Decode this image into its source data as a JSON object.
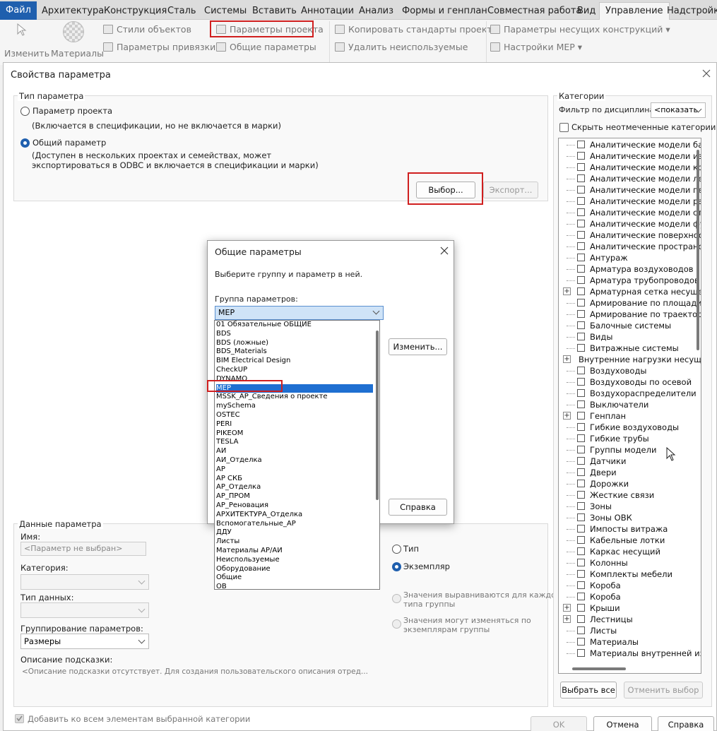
{
  "ribbon_tabs": [
    "Файл",
    "Архитектура",
    "Конструкция",
    "Сталь",
    "Системы",
    "Вставить",
    "Аннотации",
    "Анализ",
    "Формы и генплан",
    "Совместная работа",
    "Вид",
    "Управление",
    "Надстройки"
  ],
  "ribbon": {
    "modify": "Изменить",
    "materials": "Материалы",
    "object_styles": "Стили объектов",
    "snap_settings": "Параметры привязки",
    "project_parameters": "Параметры проекта",
    "shared_parameters": "Общие параметры",
    "transfer_standards": "Копировать стандарты проекта",
    "purge_unused": "Удалить неиспользуемые",
    "structural_settings": "Параметры несущих конструкций ▾",
    "mep_settings": "Настройки MEP ▾"
  },
  "dialog": {
    "title": "Свойства параметра",
    "param_type_group": "Тип параметра",
    "project_param": "Параметр проекта",
    "project_param_desc": "(Включается в спецификации, но не включается в марки)",
    "shared_param": "Общий параметр",
    "shared_param_desc1": "(Доступен в нескольких проектах и семействах, может",
    "shared_param_desc2": "экспортироваться в ODBC и включается в спецификации и марки)",
    "select_btn": "Выбор...",
    "export_btn": "Экспорт...",
    "param_data_group": "Данные параметра",
    "name_label": "Имя:",
    "name_placeholder": "<Параметр не выбран>",
    "category_label": "Категория:",
    "datatype_label": "Тип данных:",
    "grouping_label": "Группирование параметров:",
    "grouping_value": "Размеры",
    "tooltip_label": "Описание подсказки:",
    "tooltip_value": "<Описание подсказки отсутствует. Для создания пользовательского описания отред...",
    "type_radio": "Тип",
    "instance_radio": "Экземпляр",
    "align_values": "Значения выравниваются для каждого",
    "align_values2": "типа группы",
    "vary_values": "Значения могут изменяться по",
    "vary_values2": "экземплярам группы",
    "add_to_all": "Добавить ко всем элементам выбранной категории",
    "ok": "OK",
    "cancel": "Отмена",
    "help": "Справка"
  },
  "categories": {
    "title": "Категории",
    "filter_label": "Фильтр по дисциплинам:",
    "filter_value": "<показать",
    "hide_unchecked": "Скрыть неотмеченные категории",
    "select_all": "Выбрать все",
    "deselect": "Отменить выбор",
    "items": [
      {
        "label": "Аналитические модели бал",
        "expand": false
      },
      {
        "label": "Аналитические модели изо",
        "expand": false
      },
      {
        "label": "Аналитические модели кол",
        "expand": false
      },
      {
        "label": "Аналитические модели лен",
        "expand": false
      },
      {
        "label": "Аналитические модели пер",
        "expand": false
      },
      {
        "label": "Аналитические модели рас",
        "expand": false
      },
      {
        "label": "Аналитические модели ст...",
        "expand": false
      },
      {
        "label": "Аналитические модели фун",
        "expand": false
      },
      {
        "label": "Аналитические поверхнос...",
        "expand": false
      },
      {
        "label": "Аналитические пространст",
        "expand": false
      },
      {
        "label": "Антураж",
        "expand": false
      },
      {
        "label": "Арматура воздуховодов",
        "expand": false
      },
      {
        "label": "Арматура трубопроводов",
        "expand": false
      },
      {
        "label": "Арматурная сетка несущей",
        "expand": true
      },
      {
        "label": "Армирование по площади н",
        "expand": false
      },
      {
        "label": "Армирование по траектори",
        "expand": false
      },
      {
        "label": "Балочные системы",
        "expand": false
      },
      {
        "label": "Виды",
        "expand": false
      },
      {
        "label": "Витражные системы",
        "expand": false
      },
      {
        "label": "Внутренние нагрузки несущих",
        "expand": true,
        "nocheck": true
      },
      {
        "label": "Воздуховоды",
        "expand": false
      },
      {
        "label": "Воздуховоды по осевой",
        "expand": false
      },
      {
        "label": "Воздухораспределители",
        "expand": false
      },
      {
        "label": "Выключатели",
        "expand": false
      },
      {
        "label": "Генплан",
        "expand": true
      },
      {
        "label": "Гибкие воздуховоды",
        "expand": false
      },
      {
        "label": "Гибкие трубы",
        "expand": false
      },
      {
        "label": "Группы модели",
        "expand": false
      },
      {
        "label": "Датчики",
        "expand": false
      },
      {
        "label": "Двери",
        "expand": false
      },
      {
        "label": "Дорожки",
        "expand": false
      },
      {
        "label": "Жесткие связи",
        "expand": false
      },
      {
        "label": "Зоны",
        "expand": false
      },
      {
        "label": "Зоны ОВК",
        "expand": false
      },
      {
        "label": "Импосты витража",
        "expand": false
      },
      {
        "label": "Кабельные лотки",
        "expand": false
      },
      {
        "label": "Каркас несущий",
        "expand": false
      },
      {
        "label": "Колонны",
        "expand": false
      },
      {
        "label": "Комплекты мебели",
        "expand": false
      },
      {
        "label": "Короба",
        "expand": false
      },
      {
        "label": "Короба",
        "expand": false
      },
      {
        "label": "Крыши",
        "expand": true
      },
      {
        "label": "Лестницы",
        "expand": true
      },
      {
        "label": "Листы",
        "expand": false
      },
      {
        "label": "Материалы",
        "expand": false
      },
      {
        "label": "Материалы внутренней изо",
        "expand": false
      }
    ]
  },
  "shared_dialog": {
    "title": "Общие параметры",
    "instruction": "Выберите группу и параметр в ней.",
    "group_label": "Группа параметров:",
    "group_value": "MEP",
    "edit_btn": "Изменить...",
    "help_btn": "Справка",
    "options": [
      "01 Обязательные ОБЩИЕ",
      "BDS",
      "BDS (ложные)",
      "BDS_Materials",
      "BIM Electrical Design",
      "CheckUP",
      "DYNAMO",
      "MEP",
      "MSSK_AP_Сведения о проекте",
      "mySchema",
      "OSTEC",
      "PERI",
      "PIKEOM",
      "TESLA",
      "АИ",
      "АИ_Отделка",
      "АР",
      "АР СКБ",
      "АР_Отделка",
      "АР_ПРОМ",
      "АР_Реновация",
      "АРХИТЕКТУРА_Отделка",
      "Вспомогательные_АР",
      "ДДУ",
      "Листы",
      "Материалы АР/АИ",
      "Неиспользуемые",
      "Оборудование",
      "Общие",
      "ОВ"
    ],
    "selected_index": 7
  }
}
